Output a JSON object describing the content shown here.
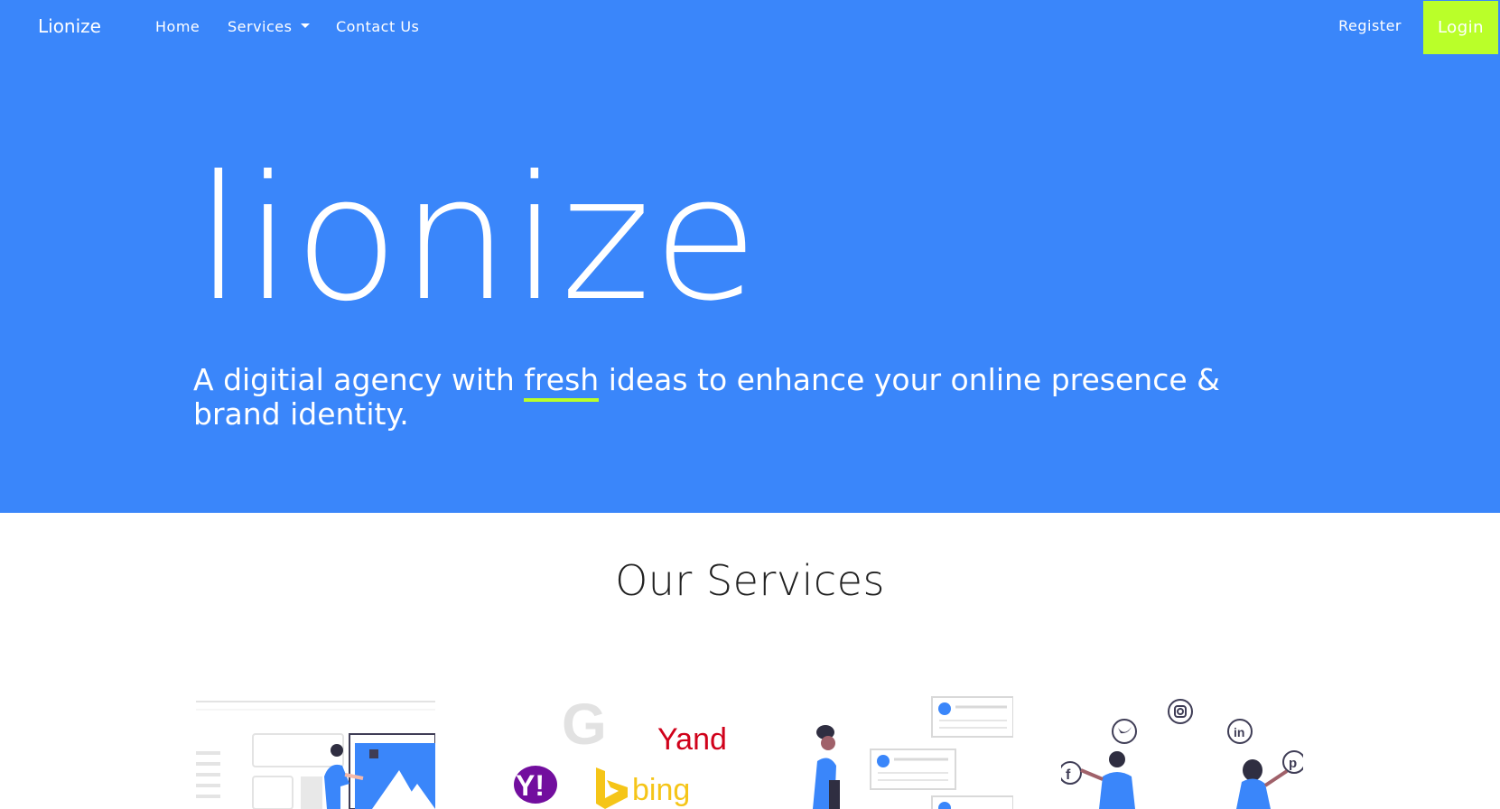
{
  "nav": {
    "brand": "Lionize",
    "home": "Home",
    "services": "Services",
    "contact": "Contact Us",
    "register": "Register",
    "login": "Login"
  },
  "hero": {
    "title": "lionize",
    "subtitle_before": "A digitial agency with ",
    "subtitle_highlight": "fresh",
    "subtitle_after": " ideas to enhance your online presence & brand identity."
  },
  "services": {
    "heading": "Our Services",
    "items": [
      {
        "icon": "web-design-illustration"
      },
      {
        "icon": "search-engines-illustration",
        "labels": {
          "google": "G",
          "yahoo": "Y!",
          "bing": "bing",
          "yandex": "Yandex"
        }
      },
      {
        "icon": "content-cards-illustration"
      },
      {
        "icon": "social-media-illustration"
      }
    ]
  },
  "colors": {
    "primary": "#3a86fa",
    "accent": "#baff29",
    "text_dark": "#222222"
  }
}
